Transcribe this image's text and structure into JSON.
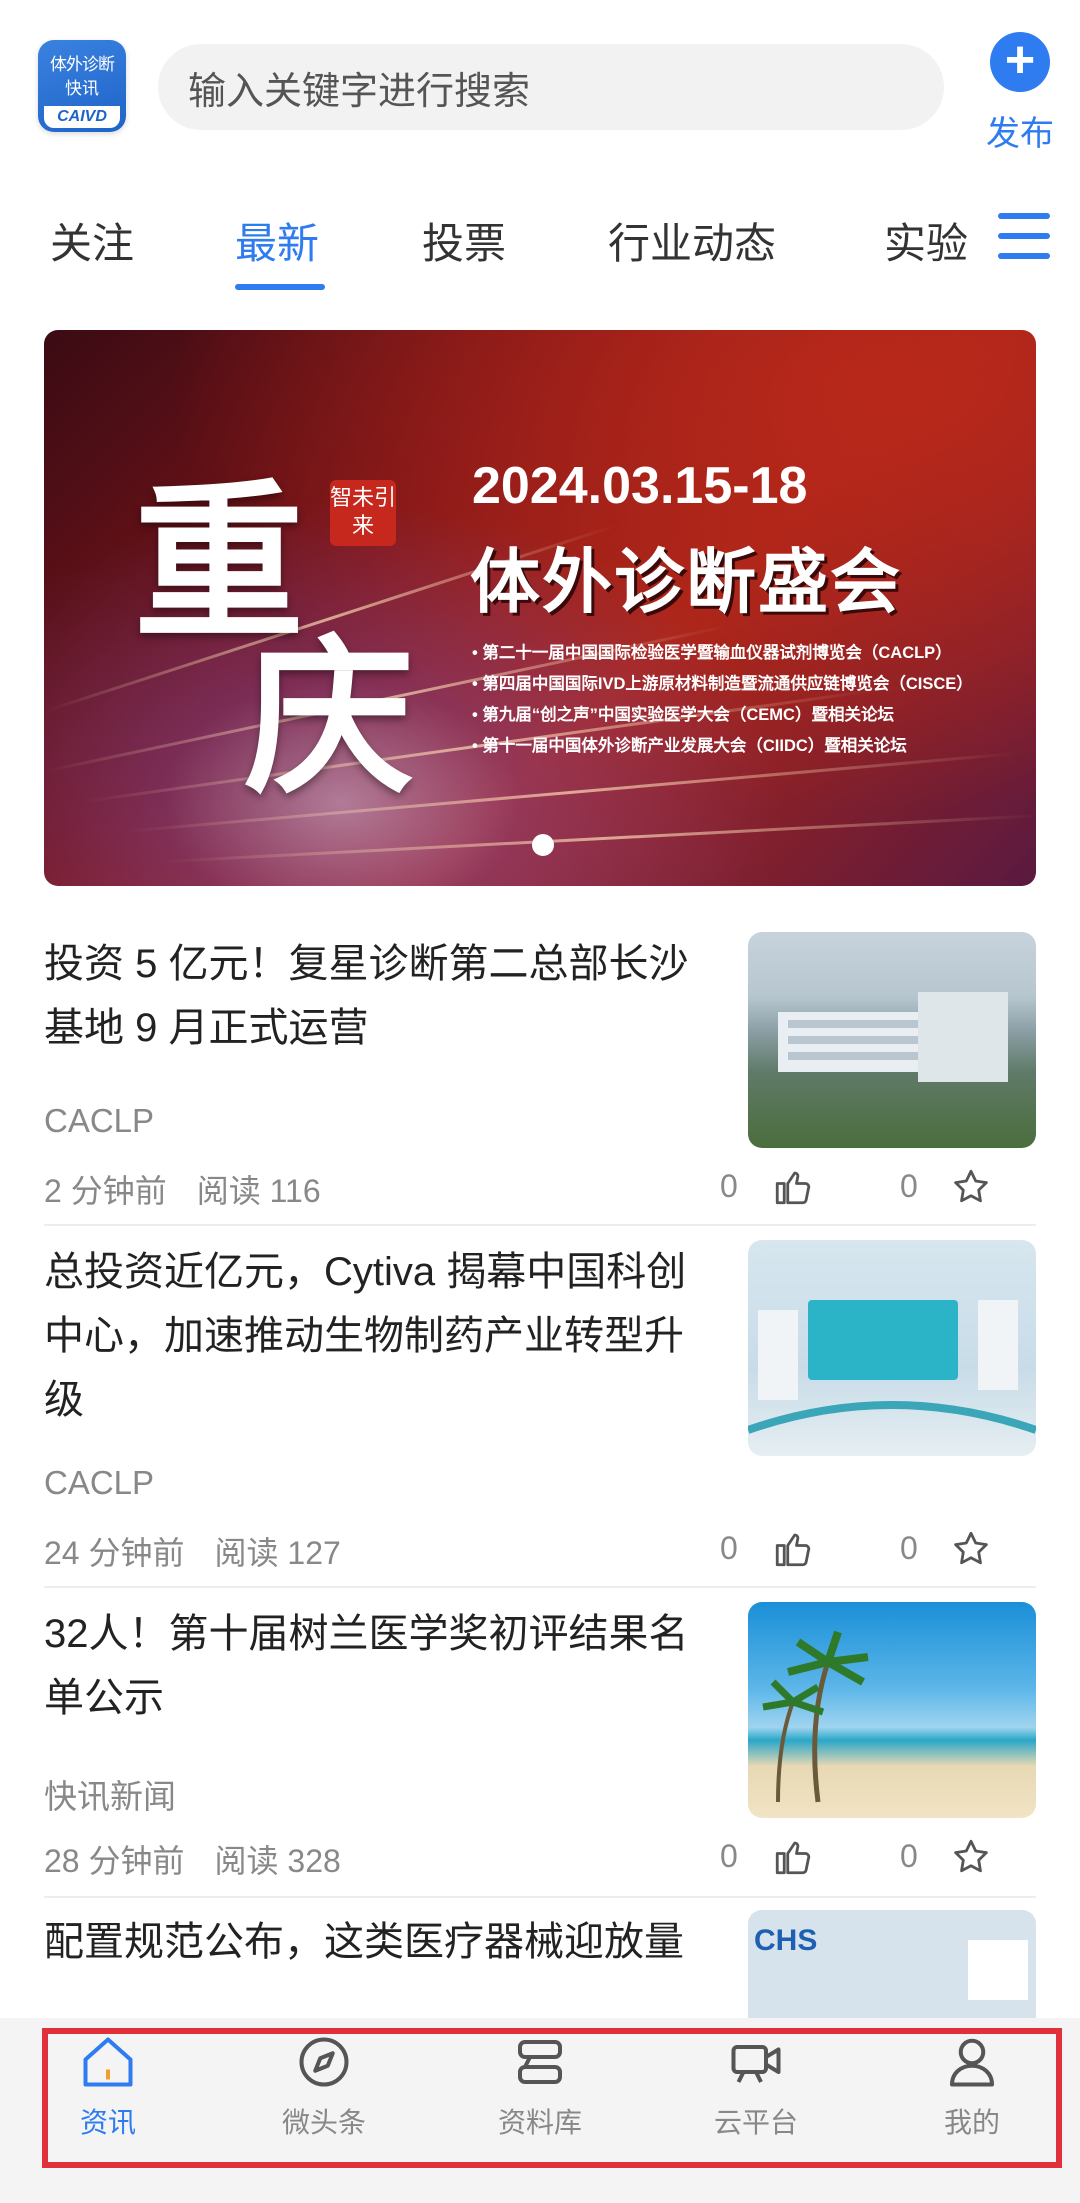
{
  "header": {
    "logo": {
      "line1": "体外诊断",
      "line2": "快讯",
      "line3": "CAIVD"
    },
    "search_placeholder": "输入关键字进行搜索",
    "publish_label": "发布"
  },
  "tabs": [
    "关注",
    "最新",
    "投票",
    "行业动态",
    "实验"
  ],
  "active_tab": "最新",
  "banner": {
    "big_text_1": "重",
    "big_text_2": "庆",
    "seal_text": "智未引来",
    "date": "2024.03.15-18",
    "title": "体外诊断盛会",
    "bullets": [
      "• 第二十一届中国国际检验医学暨输血仪器试剂博览会（CACLP）",
      "• 第四届中国国际IVD上游原材料制造暨流通供应链博览会（CISCE）",
      "• 第九届“创之声”中国实验医学大会（CEMC）暨相关论坛",
      "• 第十一届中国体外诊断产业发展大会（CIIDC）暨相关论坛"
    ]
  },
  "articles": [
    {
      "title": "投资 5 亿元！复星诊断第二总部长沙基地 9 月正式运营",
      "source": "CACLP",
      "time": "2 分钟前",
      "reads": "阅读 116",
      "likes": "0",
      "favs": "0"
    },
    {
      "title": "总投资近亿元，Cytiva 揭幕中国科创中心，加速推动生物制药产业转型升级",
      "source": "CACLP",
      "time": "24 分钟前",
      "reads": "阅读 127",
      "likes": "0",
      "favs": "0"
    },
    {
      "title": "32人！第十届树兰医学奖初评结果名单公示",
      "source": "快讯新闻",
      "time": "28 分钟前",
      "reads": "阅读 328",
      "likes": "0",
      "favs": "0"
    },
    {
      "title": "配置规范公布，这类医疗器械迎放量"
    }
  ],
  "bottom_nav": [
    {
      "label": "资讯",
      "icon": "home-icon",
      "active": true
    },
    {
      "label": "微头条",
      "icon": "compass-icon",
      "active": false
    },
    {
      "label": "资料库",
      "icon": "library-icon",
      "active": false
    },
    {
      "label": "云平台",
      "icon": "video-camera-icon",
      "active": false
    },
    {
      "label": "我的",
      "icon": "user-icon",
      "active": false
    }
  ],
  "colors": {
    "accent": "#2f7cf0",
    "highlight_border": "#e0303a"
  }
}
